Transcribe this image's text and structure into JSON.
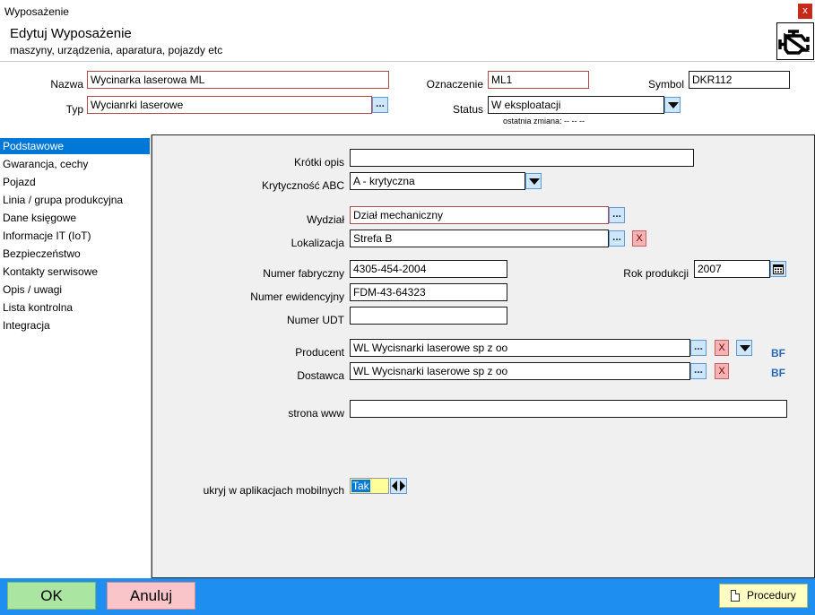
{
  "window": {
    "title": "Wyposażenie",
    "close_label": "x"
  },
  "header": {
    "title": "Edytuj Wyposażenie",
    "subtitle": "maszyny, urządzenia, aparatura, pojazdy etc"
  },
  "top_form": {
    "nazwa_label": "Nazwa",
    "nazwa_value": "Wycinarka laserowa ML",
    "typ_label": "Typ",
    "typ_value": "Wycianrki laserowe",
    "oznaczenie_label": "Oznaczenie",
    "oznaczenie_value": "ML1",
    "symbol_label": "Symbol",
    "symbol_value": "DKR112",
    "status_label": "Status",
    "status_value": "W eksploatacji",
    "last_change": "ostatnia zmiana: -- -- --"
  },
  "sidebar": {
    "items": [
      {
        "label": "Podstawowe"
      },
      {
        "label": "Gwarancja, cechy"
      },
      {
        "label": "Pojazd"
      },
      {
        "label": "Linia / grupa produkcyjna"
      },
      {
        "label": "Dane księgowe"
      },
      {
        "label": "Informacje IT (IoT)"
      },
      {
        "label": "Bezpieczeństwo"
      },
      {
        "label": "Kontakty serwisowe"
      },
      {
        "label": "Opis / uwagi"
      },
      {
        "label": "Lista kontrolna"
      },
      {
        "label": "Integracja"
      }
    ]
  },
  "main": {
    "krotki_opis_label": "Krótki opis",
    "krotki_opis_value": "",
    "krytycznosc_label": "Krytyczność ABC",
    "krytycznosc_value": "A - krytyczna",
    "wydzial_label": "Wydział",
    "wydzial_value": "Dział mechaniczny",
    "lokalizacja_label": "Lokalizacja",
    "lokalizacja_value": "Strefa B",
    "numer_fabryczny_label": "Numer fabryczny",
    "numer_fabryczny_value": "4305-454-2004",
    "rok_produkcji_label": "Rok produkcji",
    "rok_produkcji_value": "2007",
    "numer_ewidencyjny_label": "Numer ewidencyjny",
    "numer_ewidencyjny_value": "FDM-43-64323",
    "numer_udt_label": "Numer UDT",
    "numer_udt_value": "",
    "producent_label": "Producent",
    "producent_value": "WL Wycisnarki laserowe sp z oo",
    "dostawca_label": "Dostawca",
    "dostawca_value": "WL Wycisnarki laserowe sp z oo",
    "bf_label": "BF",
    "strona_www_label": "strona www",
    "strona_www_value": "",
    "mobile_label": "ukryj w aplikacjach mobilnych",
    "mobile_value": "Tak",
    "dots_label": "...",
    "x_label": "X"
  },
  "footer": {
    "ok_label": "OK",
    "cancel_label": "Anuluj",
    "procedury_label": "Procedury"
  }
}
